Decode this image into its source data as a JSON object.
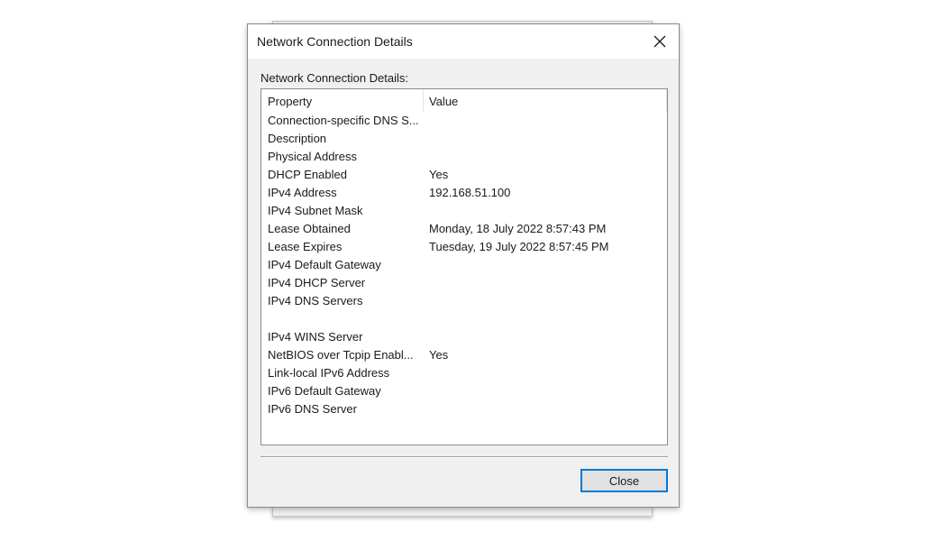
{
  "window": {
    "title": "Network Connection Details"
  },
  "group_label": "Network Connection Details:",
  "columns": {
    "property": "Property",
    "value": "Value"
  },
  "rows": [
    {
      "property": "Connection-specific DNS S...",
      "value": ""
    },
    {
      "property": "Description",
      "value": ""
    },
    {
      "property": "Physical Address",
      "value": ""
    },
    {
      "property": "DHCP Enabled",
      "value": "Yes"
    },
    {
      "property": "IPv4 Address",
      "value": "192.168.51.100"
    },
    {
      "property": "IPv4 Subnet Mask",
      "value": ""
    },
    {
      "property": "Lease Obtained",
      "value": "Monday, 18 July 2022 8:57:43 PM"
    },
    {
      "property": "Lease Expires",
      "value": "Tuesday, 19 July 2022 8:57:45 PM"
    },
    {
      "property": "IPv4 Default Gateway",
      "value": ""
    },
    {
      "property": "IPv4 DHCP Server",
      "value": ""
    },
    {
      "property": "IPv4 DNS Servers",
      "value": ""
    },
    {
      "property": "",
      "value": ""
    },
    {
      "property": "IPv4 WINS Server",
      "value": ""
    },
    {
      "property": "NetBIOS over Tcpip Enabl...",
      "value": "Yes"
    },
    {
      "property": "Link-local IPv6 Address",
      "value": ""
    },
    {
      "property": "IPv6 Default Gateway",
      "value": ""
    },
    {
      "property": "IPv6 DNS Server",
      "value": ""
    }
  ],
  "buttons": {
    "close_label": "Close"
  },
  "icons": {
    "titlebar_close": "close-icon"
  },
  "colors": {
    "accent": "#0078d7",
    "dialog_bg": "#f0f0f0",
    "list_bg": "#ffffff"
  }
}
